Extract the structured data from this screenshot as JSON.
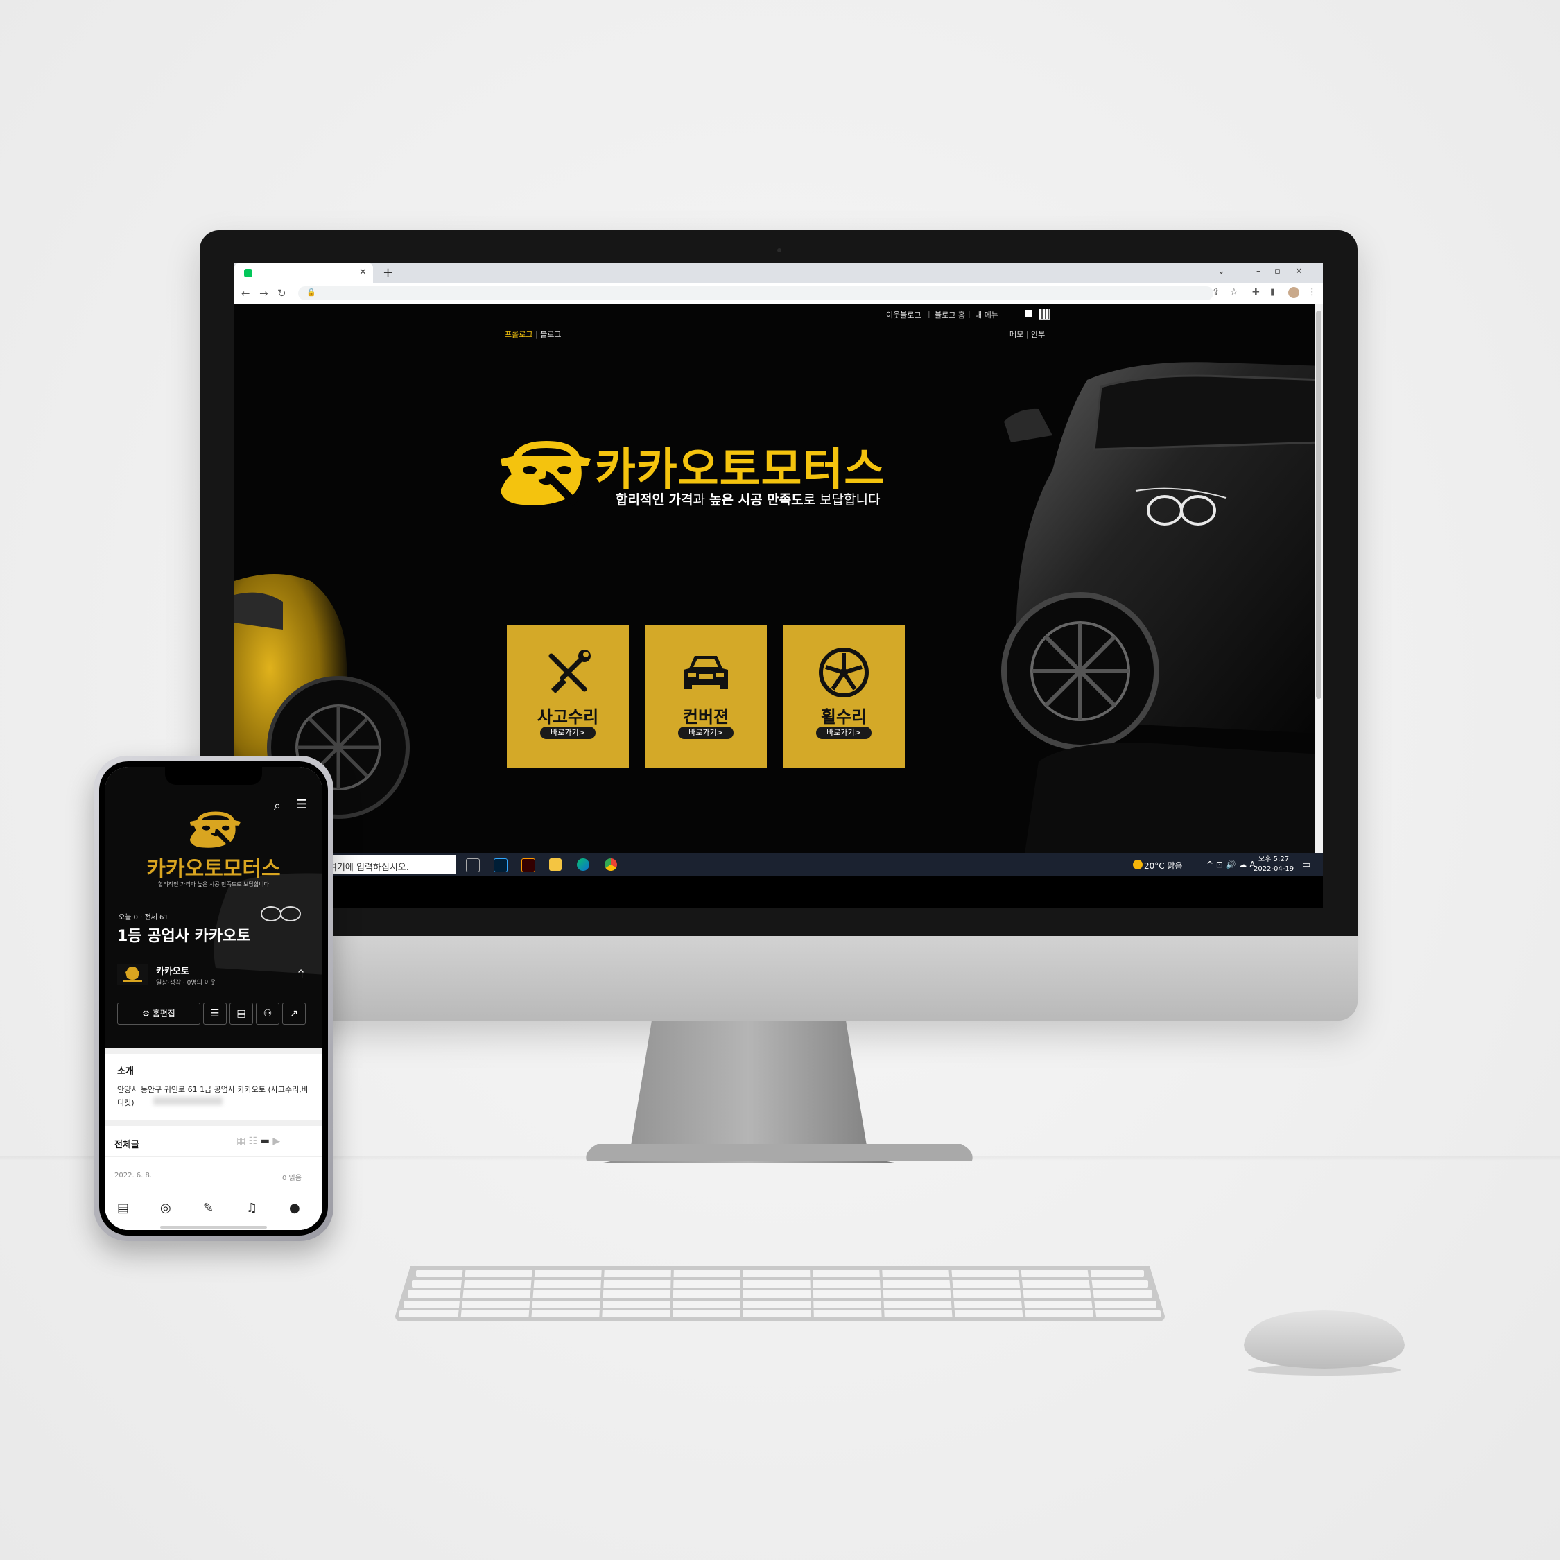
{
  "browser": {
    "new_tab": "+",
    "tab_close": "×",
    "win_min": "–",
    "win_max": "▫",
    "win_close": "×",
    "nav_back": "←",
    "nav_forward": "→",
    "nav_reload": "↻"
  },
  "blog": {
    "top_nav": {
      "neighbor": "이웃블로그",
      "home": "블로그 홈",
      "my_menu": "내 메뉴"
    },
    "gnb": {
      "prologue": "프롤로그",
      "blog": "블로그"
    },
    "util": {
      "memo": "메모",
      "guestbook": "안부"
    },
    "brand_name": "카카오토모터스",
    "tagline_1": "합리적인 가격",
    "tagline_2": "과 ",
    "tagline_3": "높은 시공 만족도",
    "tagline_4": "로 보답합니다",
    "services": [
      {
        "icon": "wrench-screwdriver-icon",
        "label": "사고수리",
        "link": "바로가기>"
      },
      {
        "icon": "car-front-icon",
        "label": "컨버젼",
        "link": "바로가기>"
      },
      {
        "icon": "wheel-icon",
        "label": "휠수리",
        "link": "바로가기>"
      }
    ],
    "accent": "#f4c30e",
    "card_color": "#d4a928"
  },
  "taskbar": {
    "search_placeholder": "여기에 입력하십시오.",
    "weather": "20°C 맑음",
    "tray": "^ ⊡ 🔊 ☁ A",
    "time": "오후 5:27",
    "date": "2022-04-19"
  },
  "phone": {
    "brand_name": "카카오토모터스",
    "tagline": "합리적인 가격과 높은 시공 만족도로 보답합니다",
    "visits": "오늘 0 · 전체 61",
    "blog_title": "1등 공업사 카카오토",
    "owner": "카카오토",
    "meta": "일상·생각 · 0명의 이웃",
    "edit_label": "⚙ 홈편집",
    "intro_heading": "소개",
    "intro_text": "안양시 동안구 귀인로 61 1급 공업사 카카오토 (사고수리,바디킷)",
    "all_posts": "전체글",
    "post_date": "2022. 6. 8.",
    "post_reads": "0 읽음"
  }
}
